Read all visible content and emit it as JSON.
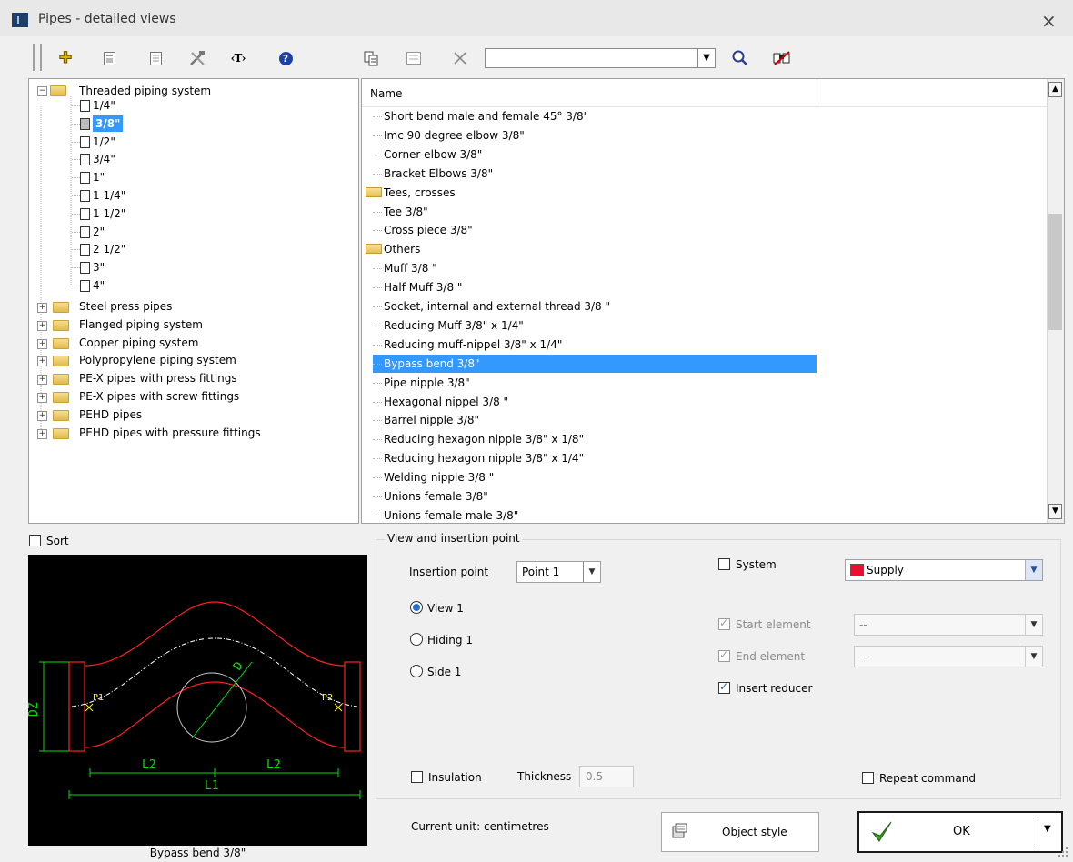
{
  "window": {
    "title": "Pipes - detailed views",
    "close": "×"
  },
  "toolbar": {
    "icons": [
      "add-icon",
      "properties-icon",
      "document-icon",
      "tools-icon",
      "text-tag-icon",
      "help-icon",
      "copy-icon",
      "card-icon",
      "delete-icon",
      "search-icon",
      "find-icon"
    ],
    "add_glyph": "✚",
    "text_tag_glyph": "‹T›",
    "help_glyph": "?",
    "combo_value": ""
  },
  "tree": {
    "root": {
      "label": "Threaded piping system",
      "expanded": true
    },
    "sizes": [
      "1/4\"",
      "3/8\"",
      "1/2\"",
      "3/4\"",
      "1\"",
      "1 1/4\"",
      "1 1/2\"",
      "2\"",
      "2 1/2\"",
      "3\"",
      "4\""
    ],
    "selected_size": "3/8\"",
    "systems": [
      "Steel press pipes",
      "Flanged piping system",
      "Copper piping system",
      "Polypropylene piping system",
      "PE-X pipes with press fittings",
      "PE-X pipes with screw fittings",
      "PEHD pipes",
      "PEHD pipes with pressure fittings"
    ]
  },
  "list": {
    "header": "Name",
    "items": [
      {
        "label": "Short bend male and female 45° 3/8\"",
        "type": "item"
      },
      {
        "label": "Imc 90 degree elbow 3/8\"",
        "type": "item"
      },
      {
        "label": "Corner elbow 3/8\"",
        "type": "item"
      },
      {
        "label": "Bracket Elbows 3/8\"",
        "type": "item"
      },
      {
        "label": "Tees, crosses",
        "type": "folder"
      },
      {
        "label": "Tee 3/8\"",
        "type": "item"
      },
      {
        "label": "Cross piece 3/8\"",
        "type": "item"
      },
      {
        "label": "Others",
        "type": "folder"
      },
      {
        "label": "Muff 3/8 \"",
        "type": "item"
      },
      {
        "label": "Half Muff 3/8 \"",
        "type": "item"
      },
      {
        "label": "Socket, internal and external thread 3/8 \"",
        "type": "item"
      },
      {
        "label": "Reducing Muff 3/8\" x 1/4\"",
        "type": "item"
      },
      {
        "label": "Reducing muff-nippel 3/8\" x 1/4\"",
        "type": "item"
      },
      {
        "label": "Bypass bend 3/8\"",
        "type": "item",
        "selected": true
      },
      {
        "label": "Pipe nipple 3/8\"",
        "type": "item"
      },
      {
        "label": "Hexagonal nippel 3/8 \"",
        "type": "item"
      },
      {
        "label": "Barrel nipple 3/8\"",
        "type": "item"
      },
      {
        "label": "Reducing hexagon nipple 3/8\" x 1/8\"",
        "type": "item"
      },
      {
        "label": "Reducing hexagon nipple 3/8\" x 1/4\"",
        "type": "item"
      },
      {
        "label": "Welding nipple 3/8 \"",
        "type": "item"
      },
      {
        "label": "Unions female 3/8\"",
        "type": "item"
      },
      {
        "label": "Unions female male 3/8\"",
        "type": "item"
      }
    ]
  },
  "sort": {
    "label": "Sort",
    "checked": false
  },
  "preview": {
    "caption": "Bypass bend 3/8\"",
    "labels": {
      "d": "D",
      "dz": "DZ",
      "p1": "P1",
      "p2": "P2",
      "l2": "L2",
      "l1": "L1"
    },
    "colors": {
      "body": "#ff2020",
      "dim": "#00e000",
      "axis": "#ffffff",
      "marker": "#ffff00"
    }
  },
  "view": {
    "group_title": "View and insertion point",
    "insertion_label": "Insertion point",
    "insertion_value": "Point 1",
    "views": [
      {
        "label": "View 1",
        "checked": true
      },
      {
        "label": "Hiding 1",
        "checked": false
      },
      {
        "label": "Side 1",
        "checked": false
      }
    ],
    "system": {
      "label": "System",
      "checked": false,
      "value": "Supply",
      "color": "#e8102e"
    },
    "start_element": {
      "label": "Start element",
      "checked": true,
      "value": "--"
    },
    "end_element": {
      "label": "End element",
      "checked": true,
      "value": "--"
    },
    "insert_reducer": {
      "label": "Insert reducer",
      "checked": true
    },
    "insulation": {
      "label": "Insulation",
      "checked": false
    },
    "thickness": {
      "label": "Thickness",
      "value": "0.5"
    },
    "repeat": {
      "label": "Repeat command",
      "checked": false
    }
  },
  "footer": {
    "unit": "Current unit: centimetres",
    "object_style": "Object style",
    "ok": "OK"
  }
}
